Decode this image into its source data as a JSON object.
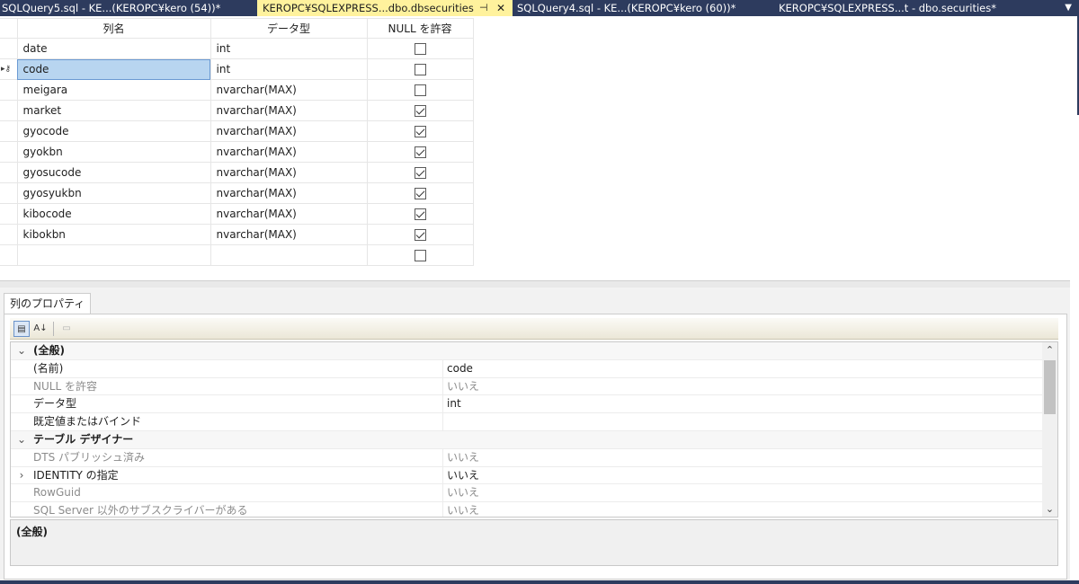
{
  "tabs": [
    {
      "label": "SQLQuery5.sql - KE...(KEROPC¥kero (54))*",
      "active": false
    },
    {
      "label": "KEROPC¥SQLEXPRESS...dbo.dbsecurities",
      "active": true,
      "pin": "⊣",
      "close": "✕"
    },
    {
      "label": "SQLQuery4.sql - KE...(KEROPC¥kero (60))*",
      "active": false
    },
    {
      "label": "KEROPC¥SQLEXPRESS...t - dbo.securities*",
      "active": false
    }
  ],
  "tab_menu_icon": "▼",
  "grid": {
    "headers": {
      "name": "列名",
      "type": "データ型",
      "null": "NULL を許容"
    },
    "rows": [
      {
        "name": "date",
        "type": "int",
        "nullable": false
      },
      {
        "name": "code",
        "type": "int",
        "nullable": false,
        "selected": true,
        "primary_key": true
      },
      {
        "name": "meigara",
        "type": "nvarchar(MAX)",
        "nullable": false
      },
      {
        "name": "market",
        "type": "nvarchar(MAX)",
        "nullable": true
      },
      {
        "name": "gyocode",
        "type": "nvarchar(MAX)",
        "nullable": true
      },
      {
        "name": "gyokbn",
        "type": "nvarchar(MAX)",
        "nullable": true
      },
      {
        "name": "gyosucode",
        "type": "nvarchar(MAX)",
        "nullable": true
      },
      {
        "name": "gyosyukbn",
        "type": "nvarchar(MAX)",
        "nullable": true
      },
      {
        "name": "kibocode",
        "type": "nvarchar(MAX)",
        "nullable": true
      },
      {
        "name": "kibokbn",
        "type": "nvarchar(MAX)",
        "nullable": true
      },
      {
        "name": "",
        "type": "",
        "nullable": false
      }
    ]
  },
  "properties": {
    "tab_label": "列のプロパティ",
    "toolbar": {
      "categorized_icon": "▤",
      "sort_icon": "A↓",
      "pages_icon": "▭"
    },
    "rows": [
      {
        "kind": "cat",
        "expander": "⌄",
        "name": "(全般)",
        "value": ""
      },
      {
        "kind": "prop",
        "name": "(名前)",
        "value": "code",
        "disabled": false
      },
      {
        "kind": "prop",
        "name": "NULL を許容",
        "value": "いいえ",
        "disabled": true
      },
      {
        "kind": "prop",
        "name": "データ型",
        "value": "int",
        "disabled": false
      },
      {
        "kind": "prop",
        "name": "既定値またはバインド",
        "value": "",
        "disabled": false
      },
      {
        "kind": "cat",
        "expander": "⌄",
        "name": "テーブル デザイナー",
        "value": ""
      },
      {
        "kind": "prop",
        "name": "DTS パブリッシュ済み",
        "value": "いいえ",
        "disabled": true
      },
      {
        "kind": "prop",
        "expander": "›",
        "name": "IDENTITY の指定",
        "value": "いいえ",
        "disabled": false
      },
      {
        "kind": "prop",
        "name": "RowGuid",
        "value": "いいえ",
        "disabled": true
      },
      {
        "kind": "prop",
        "name": "SQL Server 以外のサブスクライバーがある",
        "value": "いいえ",
        "disabled": true
      }
    ],
    "scroll_up": "⌃",
    "scroll_down": "⌄",
    "description": "(全般)"
  }
}
